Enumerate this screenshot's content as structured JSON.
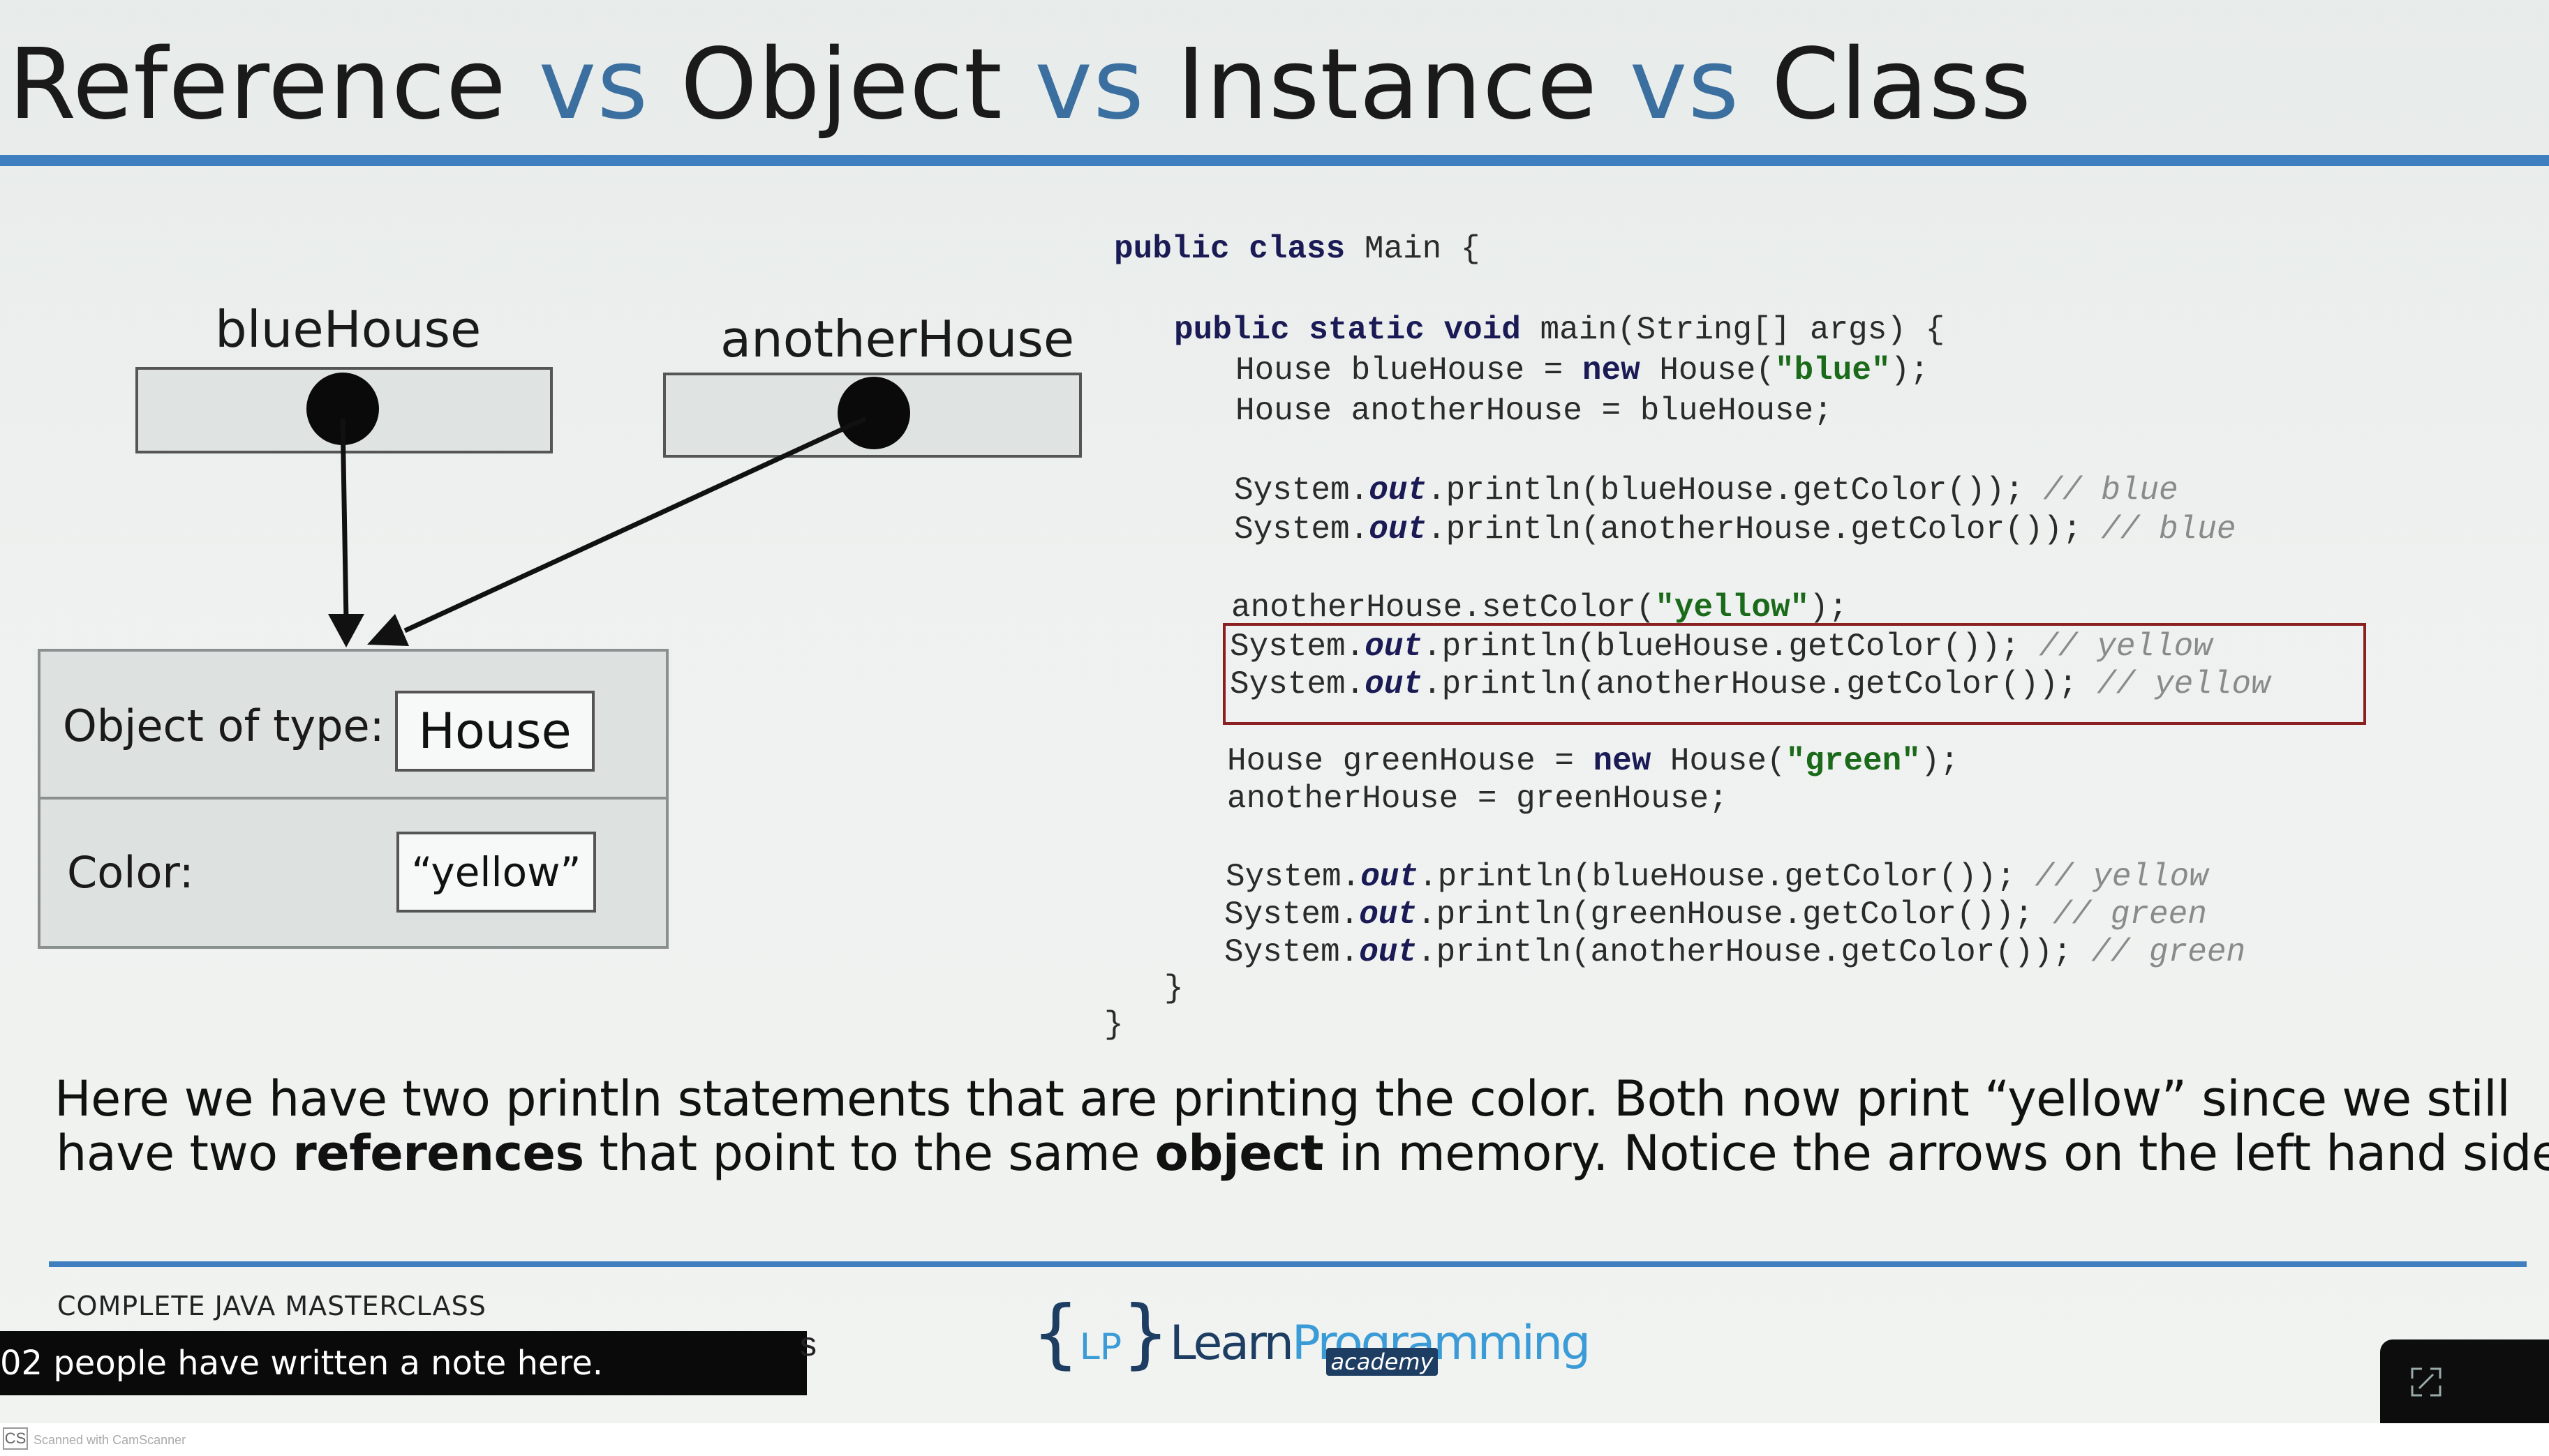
{
  "title": {
    "part1": "Reference",
    "vs1": " vs ",
    "part2": "Object",
    "vs2": " vs ",
    "part3": "Instance",
    "vs3": " vs ",
    "part4": "Class"
  },
  "diagram": {
    "ref1_label": "blueHouse",
    "ref2_label": "anotherHouse",
    "object_type_label": "Object of type:",
    "object_type_value": "House",
    "color_label": "Color:",
    "color_value": "“yellow”"
  },
  "code": {
    "l1_kw": "public class",
    "l1_rest": " Main {",
    "l2_kw": "public static void",
    "l2_rest": " main(String[] args) {",
    "l3_a": "House blueHouse = ",
    "l3_new": "new",
    "l3_b": " House(",
    "l3_str": "\"blue\"",
    "l3_c": ");",
    "l4": "House anotherHouse = blueHouse;",
    "l5_a": "System.",
    "l5_out": "out",
    "l5_b": ".println(blueHouse.getColor()); ",
    "l5_cm": "// blue",
    "l6_a": "System.",
    "l6_out": "out",
    "l6_b": ".println(anotherHouse.getColor()); ",
    "l6_cm": "// blue",
    "l7_a": "anotherHouse.setColor(",
    "l7_str": "\"yellow\"",
    "l7_b": ");",
    "l8_a": "System.",
    "l8_out": "out",
    "l8_b": ".println(blueHouse.getColor()); ",
    "l8_cm": "// yellow",
    "l9_a": "System.",
    "l9_out": "out",
    "l9_b": ".println(anotherHouse.getColor()); ",
    "l9_cm": "// yellow",
    "l10_a": "House greenHouse = ",
    "l10_new": "new",
    "l10_b": " House(",
    "l10_str": "\"green\"",
    "l10_c": ");",
    "l11": "anotherHouse = greenHouse;",
    "l12_a": "System.",
    "l12_out": "out",
    "l12_b": ".println(blueHouse.getColor()); ",
    "l12_cm": "// yellow",
    "l13_a": "System.",
    "l13_out": "out",
    "l13_b": ".println(greenHouse.getColor()); ",
    "l13_cm": "// green",
    "l14_a": "System.",
    "l14_out": "out",
    "l14_b": ".println(anotherHouse.getColor()); ",
    "l14_cm": "// green",
    "close_inner": "}",
    "close_outer": "}"
  },
  "explanation": {
    "line1": "Here we have two println statements that are printing the color. Both now print “yellow” since we still",
    "line2_a": "have two ",
    "line2_b": "references",
    "line2_c": " that point to the same ",
    "line2_d": "object",
    "line2_e": " in memory. Notice the arrows on the left hand side."
  },
  "footer": {
    "course_name": "COMPLETE JAVA MASTERCLASS",
    "note_text": "02 people have written a note here.",
    "note_trailing": "s",
    "logo_brace_open": "{",
    "logo_lp": "LP",
    "logo_brace_close": "}",
    "logo_learn": "Learn",
    "logo_programming": "Programming",
    "logo_academy": "academy",
    "scanner_badge": "CS",
    "scanner_text": "Scanned with CamScanner"
  },
  "icons": {
    "expand": "expand-icon"
  },
  "colors": {
    "accent_blue": "#3f7fc0",
    "highlight_red": "#8a2020",
    "string_green": "#1a6a1a",
    "keyword_navy": "#1a1a55",
    "comment_gray": "#8a8a8a"
  }
}
